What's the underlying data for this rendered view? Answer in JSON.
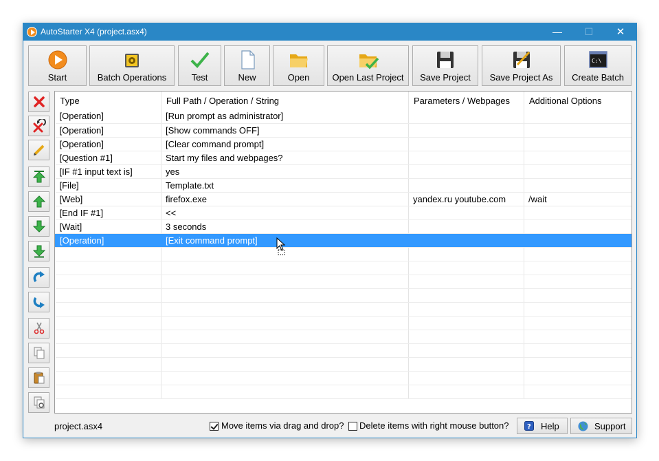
{
  "window": {
    "title": "AutoStarter X4 (project.asx4)",
    "controls": {
      "minimize": "—",
      "maximize": "☐",
      "close": "✕"
    }
  },
  "toolbar": [
    {
      "label": "Start",
      "icon": "play-circle-icon"
    },
    {
      "label": "Batch Operations",
      "icon": "gear-folder-icon"
    },
    {
      "label": "Test",
      "icon": "checkmark-icon"
    },
    {
      "label": "New",
      "icon": "new-document-icon"
    },
    {
      "label": "Open",
      "icon": "folder-open-icon"
    },
    {
      "label": "Open Last Project",
      "icon": "folder-check-icon"
    },
    {
      "label": "Save Project",
      "icon": "floppy-disk-icon"
    },
    {
      "label": "Save Project As",
      "icon": "floppy-pencil-icon"
    },
    {
      "label": "Create Batch",
      "icon": "command-prompt-icon"
    }
  ],
  "side_tools": [
    {
      "icon": "delete-icon"
    },
    {
      "icon": "delete-undo-icon"
    },
    {
      "icon": "edit-pencil-icon"
    },
    {
      "icon": "move-top-icon"
    },
    {
      "icon": "move-up-icon"
    },
    {
      "icon": "move-down-icon"
    },
    {
      "icon": "move-bottom-icon"
    },
    {
      "icon": "indent-up-icon"
    },
    {
      "icon": "indent-down-icon"
    },
    {
      "icon": "cut-icon"
    },
    {
      "icon": "copy-icon"
    },
    {
      "icon": "paste-icon"
    },
    {
      "icon": "duplicate-icon"
    }
  ],
  "table": {
    "columns": [
      "Type",
      "Full Path / Operation / String",
      "Parameters / Webpages",
      "Additional Options"
    ],
    "rows": [
      [
        "[Operation]",
        "[Run prompt as administrator]",
        "",
        ""
      ],
      [
        "[Operation]",
        "[Show commands OFF]",
        "",
        ""
      ],
      [
        "[Operation]",
        "[Clear command prompt]",
        "",
        ""
      ],
      [
        "[Question #1]",
        "Start my files and webpages?",
        "",
        ""
      ],
      [
        "[IF #1 input text is]",
        "yes",
        "",
        ""
      ],
      [
        "[File]",
        "Template.txt",
        "",
        ""
      ],
      [
        "[Web]",
        "firefox.exe",
        "yandex.ru youtube.com",
        "/wait"
      ],
      [
        "[End IF #1]",
        "<<",
        "",
        ""
      ],
      [
        "[Wait]",
        "3 seconds",
        "",
        ""
      ],
      [
        "[Operation]",
        "[Exit command prompt]",
        "",
        ""
      ]
    ],
    "selected_row": 9
  },
  "status": {
    "project_file": "project.asx4",
    "drag_drop_label": "Move items via drag and drop?",
    "drag_drop_checked": true,
    "right_delete_label": "Delete items with right mouse button?",
    "right_delete_checked": false,
    "help_label": "Help",
    "support_label": "Support"
  },
  "colors": {
    "titlebar": "#2a87c6",
    "selection": "#3399ff",
    "start_orange": "#f28c1e",
    "arrow_green": "#3db34a",
    "delete_red": "#e02424"
  }
}
